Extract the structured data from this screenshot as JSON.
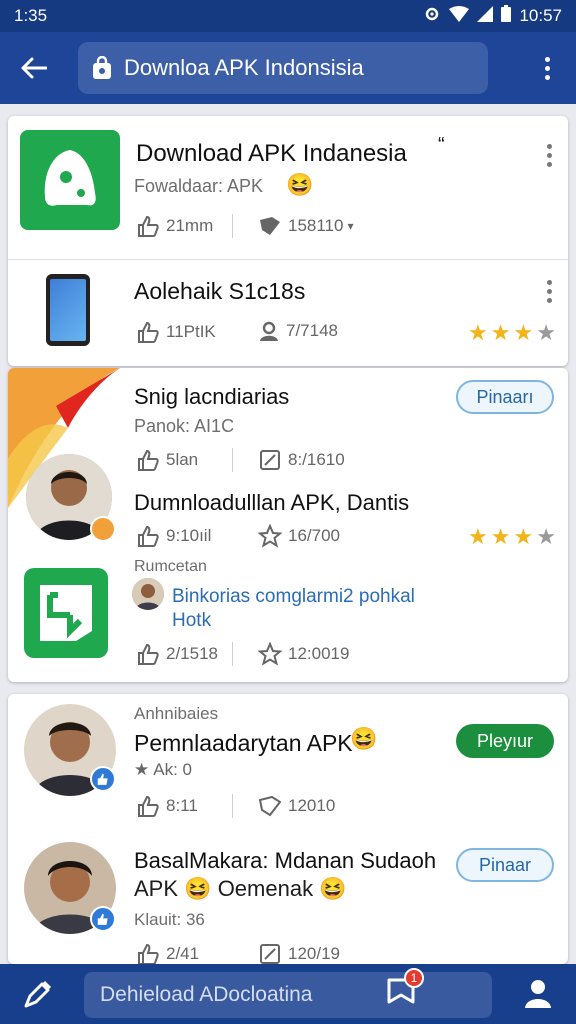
{
  "status": {
    "time": "1:35",
    "clock": "10:57"
  },
  "header": {
    "search_text": "Downloa APK Indonsisia"
  },
  "card1": {
    "title": "Download APK Indanesia",
    "title_suffix": "“",
    "subtitle": "Fowaldaar: APK",
    "emoji": "😆",
    "likes": "21mm",
    "reviews": "158110",
    "reviews_caret": "▾"
  },
  "card1b": {
    "title": "Aolehaik S1c18s",
    "likes": "11PtIK",
    "users": "7/7148",
    "rating": 3
  },
  "card2": {
    "title": "Snig lacndiarias",
    "subtitle": "Panok: AI1C",
    "button": "Pinaarı",
    "likes": "5lan",
    "edits": "8:/1610",
    "item2_title": "Dumnloadulllan APK, Dantis",
    "item2_likes": "9:10ıil",
    "item2_stars_count": "16/700",
    "item2_rating": 3,
    "section_label": "Rumcetan",
    "comment": "Binkorias comglarmi2 pohkal",
    "comment_line2": "Hotk",
    "item3_likes": "2/1518",
    "item3_stars_count": "12:0019"
  },
  "card3": {
    "label": "Anhnibaies",
    "title": "Pemnlaadarytan APK",
    "emoji": "😆",
    "button": "Pleyıur",
    "sub": "Ak: 0",
    "likes": "8:11",
    "shares": "12010",
    "item2_title": "BasalMakara: Mdanan Sudaoh",
    "item2_title2": "APK",
    "item2_line2": "Oemenak",
    "item2_button": "Pinaar",
    "item2_sub": "Klauit: 36",
    "item2_likes": "2/41",
    "item2_shares": "120/19"
  },
  "bottom": {
    "search_text": "Dehieload ADocloatina",
    "notif_count": "1"
  },
  "colors": {
    "appbar": "#1e4597",
    "status": "#153a82",
    "green": "#1b8f3d",
    "star": "#f2b418",
    "link": "#2a6db5"
  }
}
